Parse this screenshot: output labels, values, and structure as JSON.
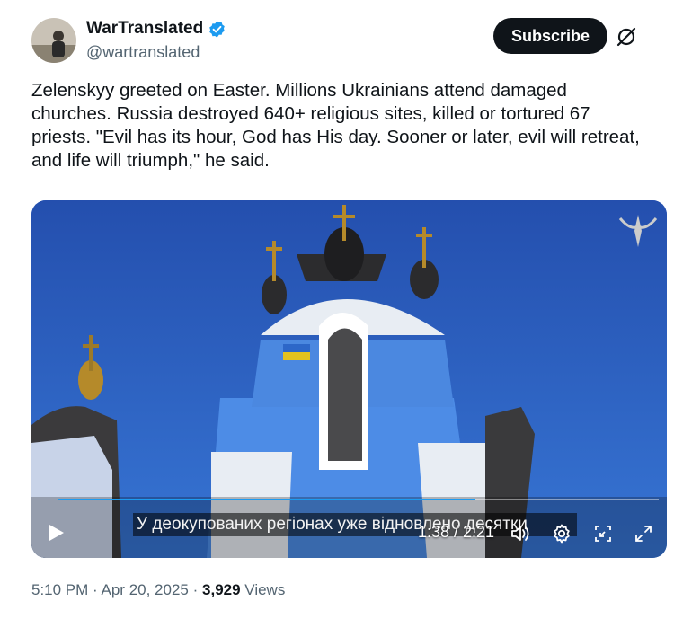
{
  "post": {
    "author_name": "WarTranslated",
    "author_handle": "@wartranslated",
    "subscribe_label": "Subscribe",
    "text": "Zelenskyy greeted on Easter. Millions Ukrainians attend damaged churches. Russia destroyed 640+ religious sites, killed or tortured 67 priests. \"Evil has its hour, God has His day. Sooner or later, evil will retreat, and life will triumph,\" he said.",
    "time": "5:10 PM",
    "date": "Apr 20, 2025",
    "separator": "·",
    "views_count": "3,929",
    "views_label": "Views"
  },
  "video": {
    "subtitle": "У деокупованих регіонах уже відновлено десятки",
    "timecode": "1:38 / 2:21",
    "progress": 0.695
  },
  "colors": {
    "accent": "#1d9bf0",
    "verified": "#1d9bf0",
    "text_primary": "#0f1419",
    "text_secondary": "#536471",
    "sky": "#2c63c6"
  },
  "icons": [
    "verified-badge-icon",
    "grok-icon",
    "play-icon",
    "volume-icon",
    "settings-icon",
    "pip-icon",
    "fullscreen-icon"
  ]
}
